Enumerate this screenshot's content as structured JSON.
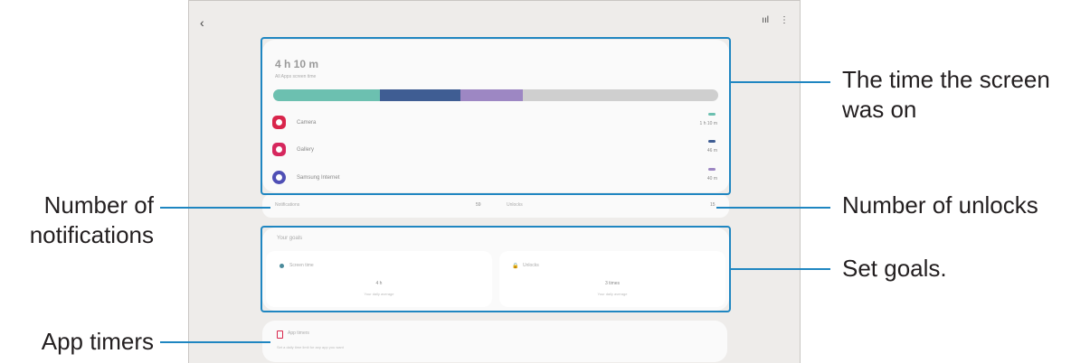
{
  "screen": {
    "back_icon": "chevron-left-icon",
    "top_icons": [
      "chart-icon",
      "more-vert-icon"
    ],
    "screen_time": "4 h 10 m",
    "screen_time_sub": "All Apps screen time",
    "usage_bar": [
      {
        "color": "#6cc0b0",
        "fraction": 0.24
      },
      {
        "color": "#3f5d93",
        "fraction": 0.18
      },
      {
        "color": "#9d87c3",
        "fraction": 0.14
      },
      {
        "color": "#cfcfcf",
        "fraction": 0.44
      }
    ],
    "apps": [
      {
        "name": "Camera",
        "time": "1 h 10 m",
        "icon_color": "#d9254b",
        "mini_color": "#6cc0b0"
      },
      {
        "name": "Gallery",
        "time": "46 m",
        "icon_color": "#d6275d",
        "mini_color": "#3f5d93"
      },
      {
        "name": "Samsung Internet",
        "time": "40 m",
        "icon_color": "#4f4fb5",
        "mini_color": "#9d87c3"
      }
    ],
    "notifications_label": "Notifications",
    "notifications_value": "59",
    "unlocks_label": "Unlocks",
    "unlocks_value": "15",
    "goals_title": "Your goals",
    "goal_screen_label": "Screen time",
    "goal_screen_value": "4 h",
    "goal_screen_sub": "Your daily average",
    "goal_unlocks_label": "Unlocks",
    "goal_unlocks_value": "3 times",
    "goal_unlocks_sub": "Your daily average",
    "app_timers_title": "App timers",
    "app_timers_sub": "Set a daily time limit for any app you want"
  },
  "callouts": {
    "screen_on": "The time the screen was on",
    "notifications": "Number of notifications",
    "unlocks": "Number of unlocks",
    "goals": "Set goals.",
    "app_timers": "App timers"
  },
  "accent_color": "#1f86c1"
}
